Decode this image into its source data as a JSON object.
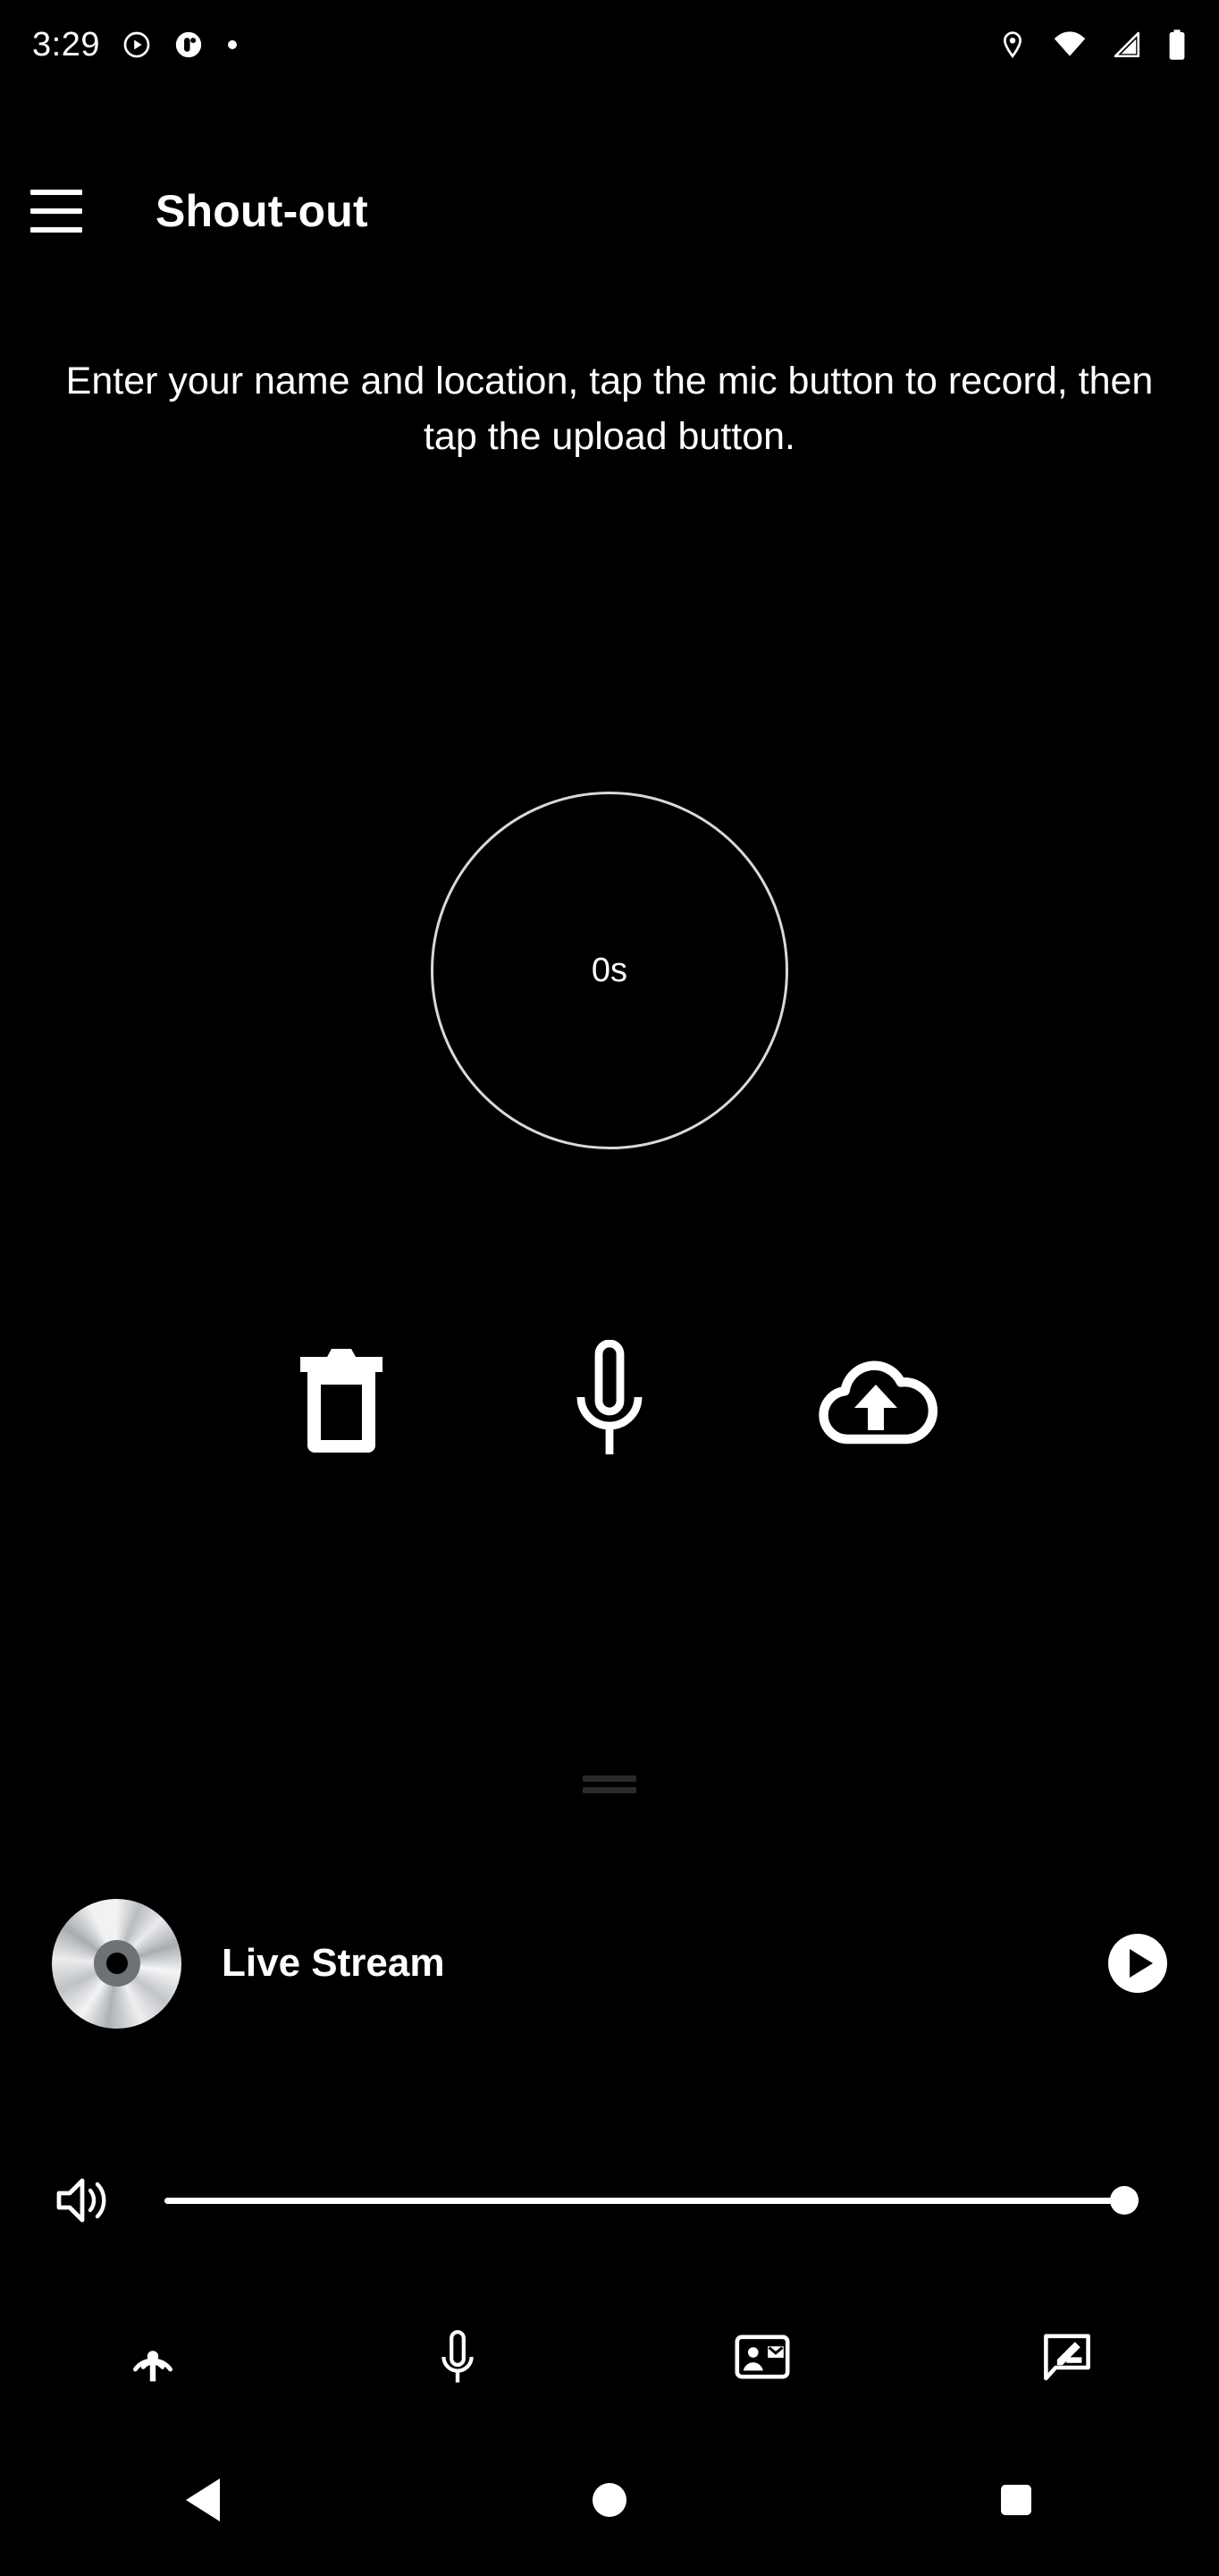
{
  "status_bar": {
    "clock": "3:29",
    "left_icons": [
      {
        "name": "play-circle-notification-icon"
      },
      {
        "name": "app-notification-icon"
      },
      {
        "name": "dot-notification-icon"
      }
    ],
    "right_icons": [
      {
        "name": "location-pin-icon"
      },
      {
        "name": "wifi-icon"
      },
      {
        "name": "cellular-signal-icon"
      },
      {
        "name": "battery-icon"
      }
    ]
  },
  "app_bar": {
    "menu_label": "Menu",
    "title": "Shout-out"
  },
  "main": {
    "instructions": "Enter your name and location, tap the mic button to record, then tap the upload button.",
    "timer": {
      "value": "0s"
    },
    "actions": [
      {
        "name": "delete-button",
        "icon": "trash-icon",
        "label": "Delete"
      },
      {
        "name": "record-button",
        "icon": "microphone-icon",
        "label": "Record"
      },
      {
        "name": "upload-button",
        "icon": "cloud-upload-icon",
        "label": "Upload"
      }
    ]
  },
  "player": {
    "drag_handle_label": "Drag handle",
    "album_art_icon": "compact-disc-icon",
    "track_title": "Live Stream",
    "play_button_icon": "play-icon",
    "play_button_label": "Play",
    "volume": {
      "icon": "volume-up-icon",
      "level": 100
    }
  },
  "tab_bar": {
    "items": [
      {
        "name": "tab-broadcast",
        "icon": "broadcast-antenna-icon",
        "label": "Broadcast"
      },
      {
        "name": "tab-microphone",
        "icon": "microphone-icon",
        "label": "Microphone"
      },
      {
        "name": "tab-contact",
        "icon": "contact-mail-icon",
        "label": "Contact"
      },
      {
        "name": "tab-feedback",
        "icon": "message-edit-icon",
        "label": "Feedback"
      }
    ]
  },
  "nav_bar": {
    "back_label": "Back",
    "home_label": "Home",
    "recents_label": "Recents"
  },
  "colors": {
    "background": "#000000",
    "foreground": "#ffffff",
    "handle": "#2a2a2a",
    "circle_outline": "#d9d9d9"
  }
}
